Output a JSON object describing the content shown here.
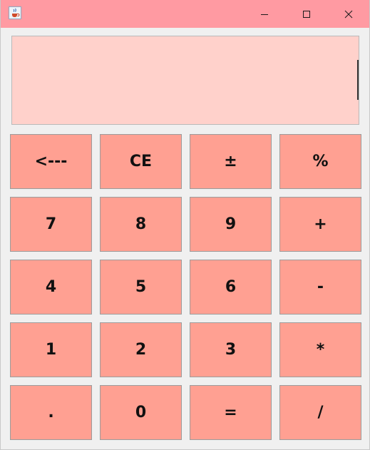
{
  "titlebar": {
    "app_icon": "java-cup-icon",
    "minimize_icon": "minimize-icon",
    "maximize_icon": "maximize-icon",
    "close_icon": "close-icon",
    "color": "#ff9aa2"
  },
  "display": {
    "value": "",
    "background": "#ffd1cb"
  },
  "keypad": {
    "key_color": "#ffa092",
    "rows": [
      [
        "<---",
        "CE",
        "±",
        "%"
      ],
      [
        "7",
        "8",
        "9",
        "+"
      ],
      [
        "4",
        "5",
        "6",
        "-"
      ],
      [
        "1",
        "2",
        "3",
        "*"
      ],
      [
        ".",
        "0",
        "=",
        "/"
      ]
    ]
  }
}
